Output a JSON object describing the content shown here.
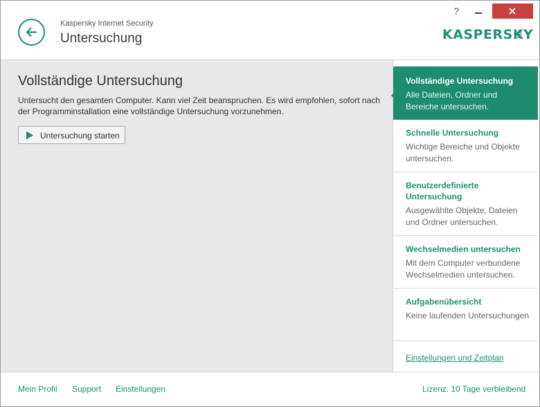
{
  "header": {
    "app_name": "Kaspersky Internet Security",
    "title": "Untersuchung",
    "help_label": "?",
    "logo_text": "KASPERSKY",
    "logo_sub": "lab"
  },
  "main": {
    "title": "Vollständige Untersuchung",
    "description": "Untersucht den gesamten Computer. Kann viel Zeit beanspruchen. Es wird empfohlen, sofort nach der Programminstallation eine vollständige Untersuchung vorzunehmen.",
    "start_button": "Untersuchung starten"
  },
  "sidebar": {
    "items": [
      {
        "title": "Vollständige Untersuchung",
        "desc": "Alle Dateien, Ordner und Bereiche untersuchen.",
        "active": true
      },
      {
        "title": "Schnelle Untersuchung",
        "desc": "Wichtige Bereiche und Objekte untersuchen."
      },
      {
        "title": "Benutzerdefinierte Untersuchung",
        "desc": "Ausgewählte Objekte, Dateien und Ordner untersuchen."
      },
      {
        "title": "Wechselmedien untersuchen",
        "desc": "Mit dem Computer verbundene Wechselmedien untersuchen."
      },
      {
        "title": "Aufgabenübersicht",
        "desc": "Keine laufenden Untersuchungen"
      }
    ],
    "settings_link": "Einstellungen und Zeitplan"
  },
  "footer": {
    "profile": "Mein Profil",
    "support": "Support",
    "settings": "Einstellungen",
    "license": "Lizenz: 10 Tage verbleibend"
  },
  "colors": {
    "accent": "#1f8f76",
    "active_bg": "#1d8c6f",
    "close_bg": "#c94040",
    "main_bg": "#e6e8ea"
  }
}
